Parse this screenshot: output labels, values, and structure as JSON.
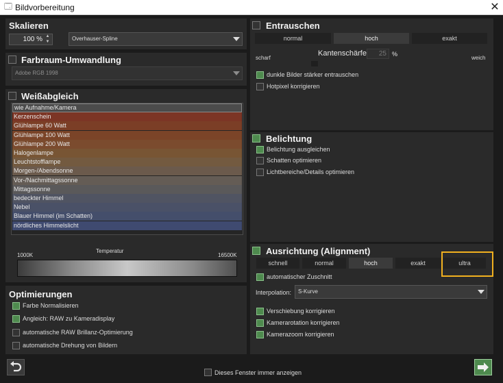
{
  "window": {
    "title": "Bildvorbereitung",
    "icon": "window-icon",
    "close_label": "✕"
  },
  "skalieren": {
    "title": "Skalieren",
    "value": "100 %",
    "method": "Overhauser-Spline"
  },
  "farbraum": {
    "title": "Farbraum-Umwandlung",
    "value": "Adobe RGB 1998"
  },
  "weissabgleich": {
    "title": "Weißabgleich",
    "items": [
      "wie Aufnahme/Kamera",
      "Kerzenschein",
      "Glühlampe 60 Watt",
      "Glühlampe 100 Watt",
      "Glühlampe 200 Watt",
      "Halogenlampe",
      "Leuchtstofflampe",
      "Morgen-/Abendsonne",
      "Vor-/Nachmittagssonne",
      "Mittagssonne",
      "bedeckter Himmel",
      "Nebel",
      "Blauer Himmel (im Schatten)",
      "nördliches Himmelslicht"
    ],
    "item_colors": [
      "#4b4b4b",
      "#7c3525",
      "#7b3e26",
      "#7b4428",
      "#7b4b2e",
      "#785534",
      "#735a40",
      "#6b5a4c",
      "#645c55",
      "#5a595a",
      "#505462",
      "#4a5167",
      "#444e6b",
      "#3f4a70"
    ],
    "selected_index": 0,
    "temp_label": "Temperatur",
    "temp_min": "1000K",
    "temp_max": "16500K"
  },
  "optimierungen": {
    "title": "Optimierungen",
    "items": [
      {
        "label": "Farbe Normalisieren",
        "checked": true
      },
      {
        "label": "Angleich: RAW zu Kameradisplay",
        "checked": true
      },
      {
        "label": "automatische RAW Brillanz-Optimierung",
        "checked": false
      },
      {
        "label": "automatische Drehung von Bildern",
        "checked": false
      }
    ]
  },
  "entrauschen": {
    "title": "Entrauschen",
    "segments": [
      "normal",
      "hoch",
      "exakt"
    ],
    "selected": "hoch",
    "sharp_label": "scharf",
    "soft_label": "weich",
    "kanten_label": "Kantenschärfe",
    "kanten_value": "25",
    "kanten_unit": "%",
    "options": [
      {
        "label": "dunkle Bilder stärker entrauschen",
        "checked": true
      },
      {
        "label": "Hotpixel korrigieren",
        "checked": false
      }
    ]
  },
  "belichtung": {
    "title": "Belichtung",
    "options": [
      {
        "label": "Belichtung ausgleichen",
        "checked": true
      },
      {
        "label": "Schatten optimieren",
        "checked": false
      },
      {
        "label": "Lichtbereiche/Details optimieren",
        "checked": false
      }
    ]
  },
  "ausrichtung": {
    "title": "Ausrichtung (Alignment)",
    "segments": [
      "schnell",
      "normal",
      "hoch",
      "exakt",
      "ultra"
    ],
    "selected": "hoch",
    "highlighted": "ultra",
    "highlight_color": "#f2b11f",
    "auto_crop": "automatischer Zuschnitt",
    "interpolation_label": "Interpolation:",
    "interpolation_value": "S-Kurve",
    "options": [
      {
        "label": "Verschiebung korrigieren",
        "checked": true
      },
      {
        "label": "Kamerarotation korrigieren",
        "checked": true
      },
      {
        "label": "Kamerazoom korrigieren",
        "checked": true
      }
    ]
  },
  "footer": {
    "show_always": "Dieses Fenster immer anzeigen",
    "back_icon": "undo-arrow-icon",
    "next_icon": "arrow-right-icon"
  }
}
